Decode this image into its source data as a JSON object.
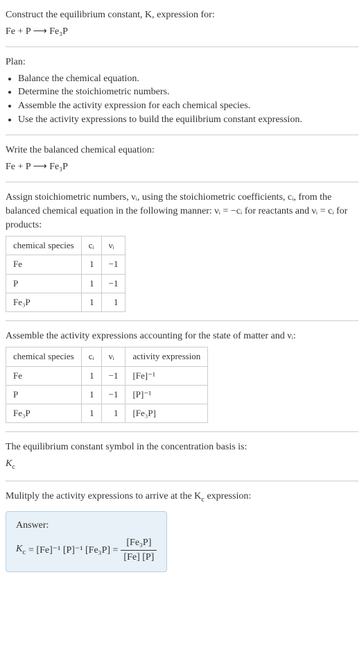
{
  "title_line1": "Construct the equilibrium constant, K, expression for:",
  "title_eq": "Fe + P  ⟶  Fe₃P",
  "plan_heading": "Plan:",
  "plan_items": [
    "Balance the chemical equation.",
    "Determine the stoichiometric numbers.",
    "Assemble the activity expression for each chemical species.",
    "Use the activity expressions to build the equilibrium constant expression."
  ],
  "balanced_heading": "Write the balanced chemical equation:",
  "balanced_eq": "Fe + P  ⟶  Fe₃P",
  "assign_text_1": "Assign stoichiometric numbers, νᵢ, using the stoichiometric coefficients, cᵢ, from the balanced chemical equation in the following manner: νᵢ = −cᵢ for reactants and νᵢ = cᵢ for products:",
  "table1": {
    "headers": [
      "chemical species",
      "cᵢ",
      "νᵢ"
    ],
    "rows": [
      [
        "Fe",
        "1",
        "−1"
      ],
      [
        "P",
        "1",
        "−1"
      ],
      [
        "Fe₃P",
        "1",
        "1"
      ]
    ]
  },
  "assemble_text": "Assemble the activity expressions accounting for the state of matter and νᵢ:",
  "table2": {
    "headers": [
      "chemical species",
      "cᵢ",
      "νᵢ",
      "activity expression"
    ],
    "rows": [
      [
        "Fe",
        "1",
        "−1",
        "[Fe]⁻¹"
      ],
      [
        "P",
        "1",
        "−1",
        "[P]⁻¹"
      ],
      [
        "Fe₃P",
        "1",
        "1",
        "[Fe₃P]"
      ]
    ]
  },
  "symbol_text": "The equilibrium constant symbol in the concentration basis is:",
  "symbol_value": "K",
  "symbol_sub": "c",
  "multiply_text": "Mulitply the activity expressions to arrive at the K",
  "multiply_suffix": " expression:",
  "answer_label": "Answer:",
  "answer_lhs_pre": "K",
  "answer_lhs_sub": "c",
  "answer_mid": " = [Fe]⁻¹ [P]⁻¹ [Fe₃P] = ",
  "answer_frac_num": "[Fe₃P]",
  "answer_frac_den": "[Fe] [P]"
}
